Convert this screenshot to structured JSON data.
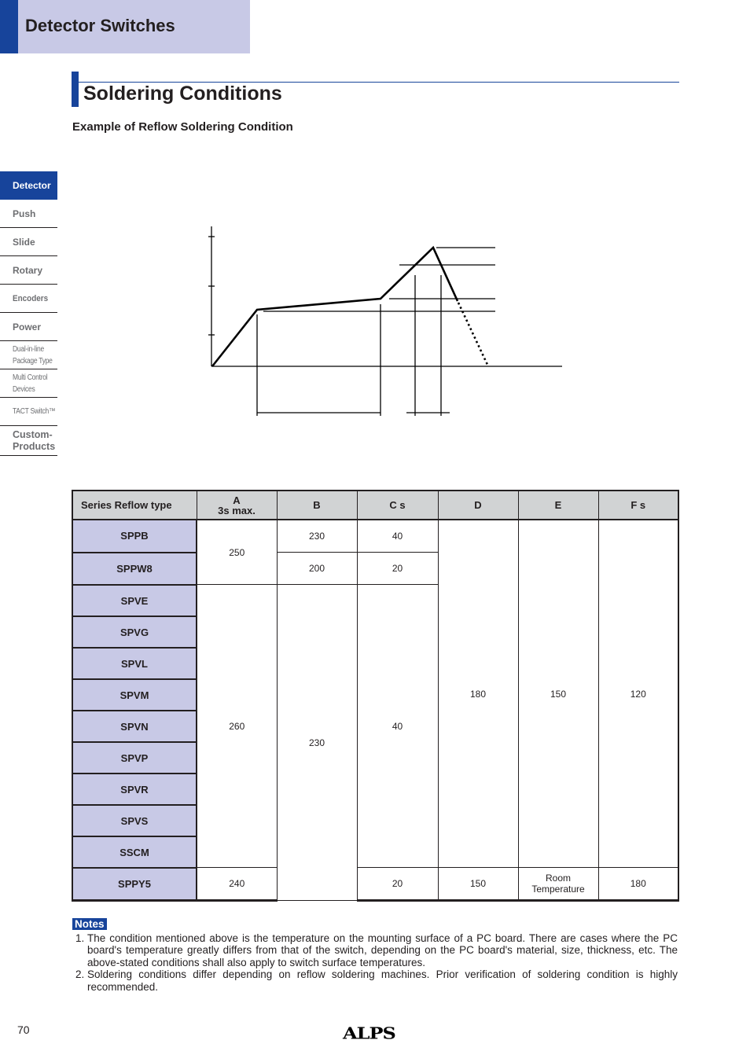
{
  "header": {
    "title": "Detector Switches",
    "accent_color": "#17449b",
    "band_color": "#c8c9e6"
  },
  "section": {
    "title": "Soldering Conditions",
    "subtitle": "Example of Reflow Soldering Condition"
  },
  "sidenav": {
    "items": [
      {
        "label": "Detector",
        "active": true
      },
      {
        "label": "Push"
      },
      {
        "label": "Slide"
      },
      {
        "label": "Rotary"
      },
      {
        "label": "Encoders"
      },
      {
        "label": "Power"
      },
      {
        "label_line1": "Dual-in-line",
        "label_line2": "Package Type"
      },
      {
        "label_line1": "Multi Control",
        "label_line2": "Devices"
      },
      {
        "label": "TACT Switch™"
      },
      {
        "label_line1": "Custom-",
        "label_line2": "Products"
      }
    ]
  },
  "diagram": {
    "description": "Reflow temperature profile curve: ramp-up, preheat plateau, peak, cooling (dotted)",
    "labels": []
  },
  "table": {
    "headers": {
      "series": "Series  Reflow type",
      "a_line1": "A",
      "a_line2": "3s max.",
      "b": "B",
      "c": "C  s",
      "d": "D",
      "e": "E",
      "f": "F  s"
    },
    "rows": [
      {
        "series": "SPPB",
        "a": "250",
        "b": "230",
        "c": "40",
        "d": "180",
        "e": "150",
        "f": "120"
      },
      {
        "series": "SPPW8",
        "a": "250",
        "b": "200",
        "c": "20",
        "d": "180",
        "e": "150",
        "f": "120"
      },
      {
        "series": "SPVE",
        "a": "260",
        "b": "230",
        "c": "40",
        "d": "180",
        "e": "150",
        "f": "120"
      },
      {
        "series": "SPVG",
        "a": "260",
        "b": "230",
        "c": "40",
        "d": "180",
        "e": "150",
        "f": "120"
      },
      {
        "series": "SPVL",
        "a": "260",
        "b": "230",
        "c": "40",
        "d": "180",
        "e": "150",
        "f": "120"
      },
      {
        "series": "SPVM",
        "a": "260",
        "b": "230",
        "c": "40",
        "d": "180",
        "e": "150",
        "f": "120"
      },
      {
        "series": "SPVN",
        "a": "260",
        "b": "230",
        "c": "40",
        "d": "180",
        "e": "150",
        "f": "120"
      },
      {
        "series": "SPVP",
        "a": "260",
        "b": "230",
        "c": "40",
        "d": "180",
        "e": "150",
        "f": "120"
      },
      {
        "series": "SPVR",
        "a": "260",
        "b": "230",
        "c": "40",
        "d": "180",
        "e": "150",
        "f": "120"
      },
      {
        "series": "SPVS",
        "a": "260",
        "b": "230",
        "c": "40",
        "d": "180",
        "e": "150",
        "f": "120"
      },
      {
        "series": "SSCM",
        "a": "260",
        "b": "230",
        "c": "40",
        "d": "180",
        "e": "150",
        "f": "120"
      },
      {
        "series": "SPPY5",
        "a": "240",
        "b": "230",
        "c": "20",
        "d": "150",
        "e_line1": "Room",
        "e_line2": "Temperature",
        "f": "180"
      }
    ]
  },
  "notes": {
    "badge": "Notes",
    "items": [
      "The condition mentioned above is the temperature on the mounting surface of a PC board. There are cases where the PC board's temperature greatly differs from that of the switch, depending on the PC board's material, size, thickness, etc. The above-stated conditions shall also apply to switch surface temperatures.",
      "Soldering conditions differ depending on reflow soldering machines. Prior verification of soldering condition is highly recommended."
    ]
  },
  "footer": {
    "page_number": "70",
    "logo": "ALPS"
  }
}
